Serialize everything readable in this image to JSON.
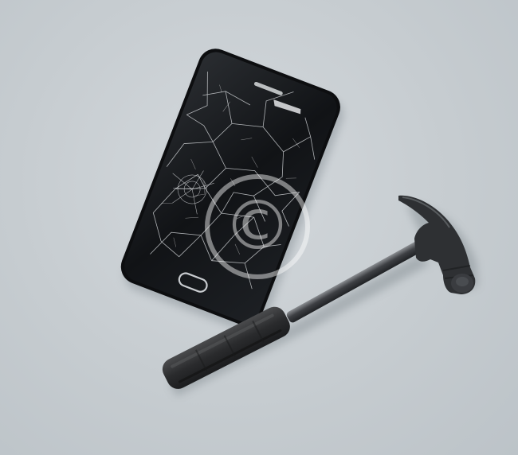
{
  "scene": {
    "background_color": "#c9cfd3",
    "subjects": [
      "smartphone-with-shattered-screen",
      "claw-hammer"
    ],
    "watermark": "©"
  }
}
